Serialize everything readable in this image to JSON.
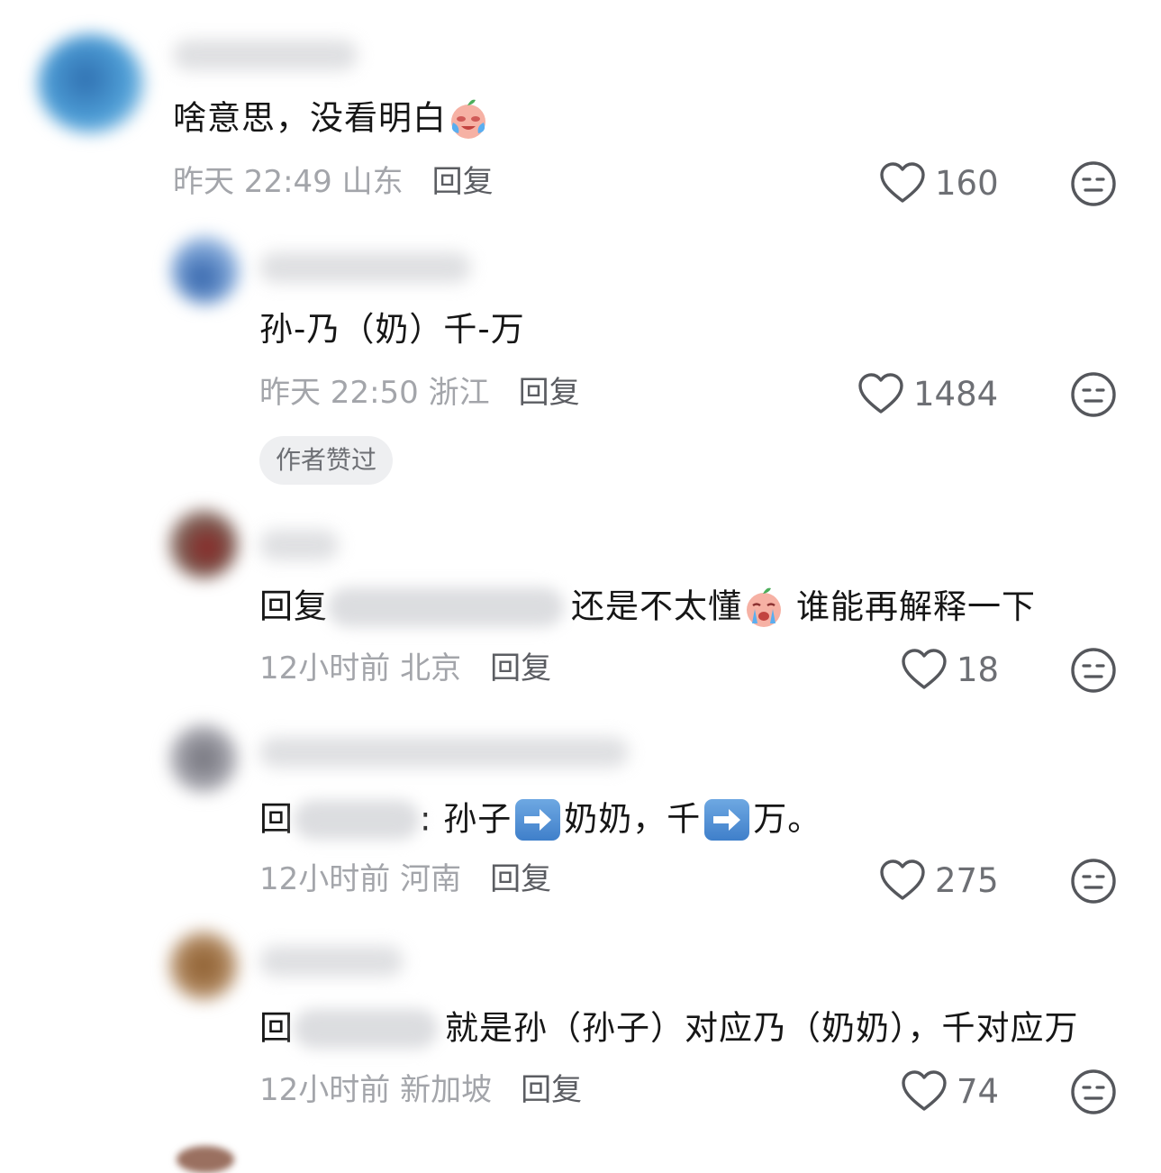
{
  "comments": [
    {
      "text": "啥意思，没看明白",
      "time": "昨天 22:49 山东",
      "reply_label": "回复",
      "likes": "160"
    },
    {
      "text": "孙-乃（奶）千-万",
      "time": "昨天 22:50 浙江",
      "reply_label": "回复",
      "likes": "1484",
      "tag": "作者赞过"
    },
    {
      "reply_prefix": "回复",
      "text": "还是不太懂",
      "text2": "谁能再解释一下",
      "time": "12小时前 北京",
      "reply_label": "回复",
      "likes": "18"
    },
    {
      "reply_prefix": "回",
      "text_a": ": 孙子",
      "text_b": "奶奶，千",
      "text_c": "万。",
      "time": "12小时前 河南",
      "reply_label": "回复",
      "likes": "275"
    },
    {
      "reply_prefix": "回",
      "text": "就是孙（孙子）对应乃（奶奶），千对应万",
      "time": "12小时前 新加坡",
      "reply_label": "回复",
      "likes": "74"
    }
  ],
  "colors": {
    "secondary_text": "#a3a5aa",
    "reply_text": "#5b5d62",
    "tag_bg": "#eeeff1"
  },
  "icons": [
    "heart-outline-icon",
    "dislike-face-icon",
    "crying-face-emoji",
    "right-arrow-emoji"
  ]
}
